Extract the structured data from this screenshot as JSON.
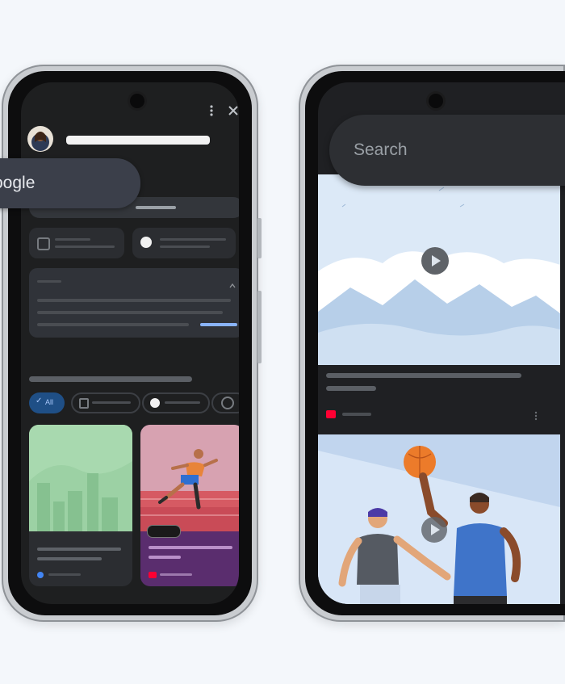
{
  "left_phone": {
    "search_chip_label": "oogle",
    "filter_chip_1": "All"
  },
  "right_phone": {
    "search_placeholder": "Search"
  }
}
